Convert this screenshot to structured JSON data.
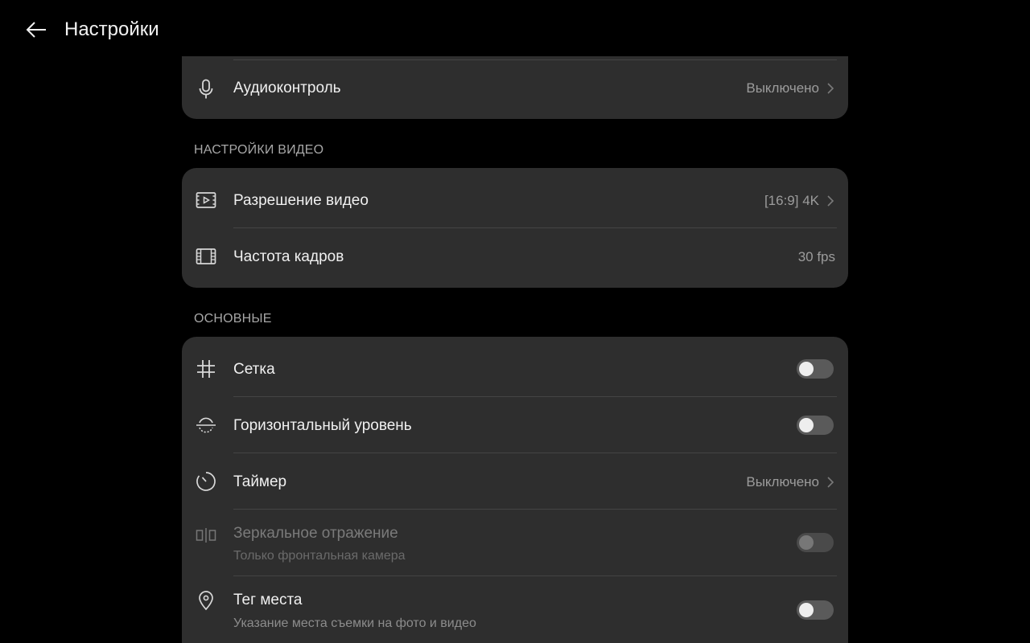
{
  "header": {
    "title": "Настройки"
  },
  "audio_card": {
    "audio_control": {
      "label": "Аудиоконтроль",
      "value": "Выключено",
      "icon": "microphone-icon"
    }
  },
  "video_section": {
    "heading": "НАСТРОЙКИ ВИДЕО",
    "resolution": {
      "label": "Разрешение видео",
      "value": "[16:9] 4K",
      "icon": "video-resolution-icon"
    },
    "frame_rate": {
      "label": "Частота кадров",
      "value": "30 fps",
      "icon": "film-icon"
    }
  },
  "general_section": {
    "heading": "ОСНОВНЫЕ",
    "grid": {
      "label": "Сетка",
      "on": false,
      "icon": "grid-icon"
    },
    "level": {
      "label": "Горизонтальный уровень",
      "on": false,
      "icon": "level-icon"
    },
    "timer": {
      "label": "Таймер",
      "value": "Выключено",
      "icon": "timer-icon"
    },
    "mirror": {
      "label": "Зеркальное отражение",
      "sublabel": "Только фронтальная камера",
      "on": false,
      "enabled": false,
      "icon": "mirror-icon"
    },
    "location": {
      "label": "Тег места",
      "sublabel": "Указание места съемки на фото и видео",
      "on": false,
      "icon": "location-pin-icon"
    }
  },
  "colors": {
    "background": "#000000",
    "card": "#2e2e2e",
    "divider": "#444444",
    "toggle_off": "#5a5a5a"
  }
}
